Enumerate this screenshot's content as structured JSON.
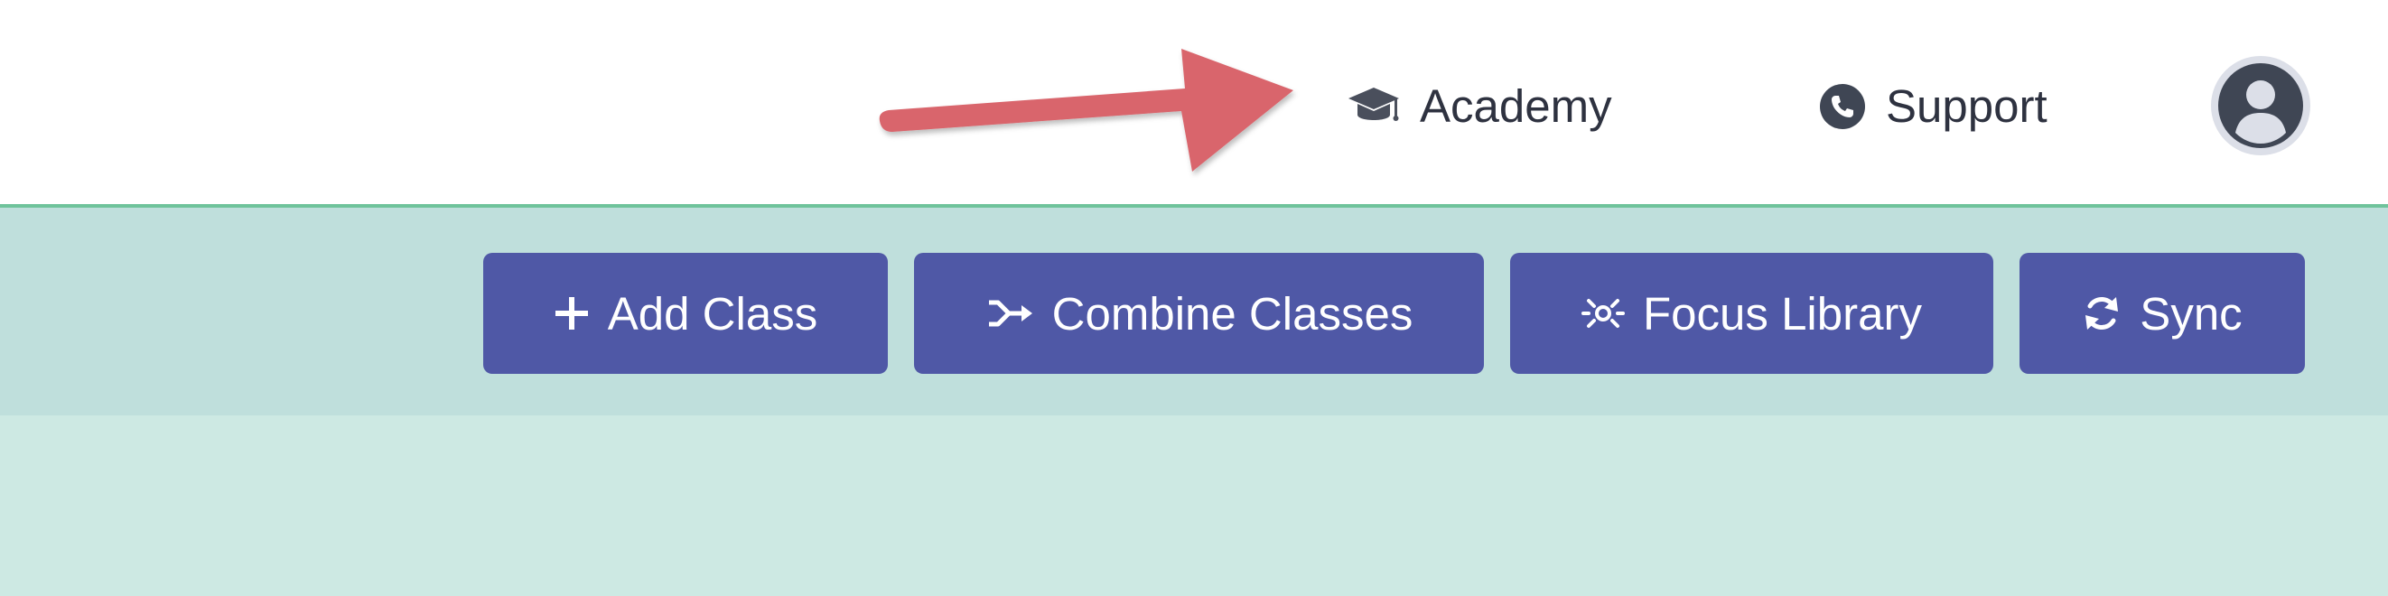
{
  "header": {
    "academy_label": "Academy",
    "support_label": "Support",
    "academy_icon": "graduation-cap-icon",
    "support_icon": "phone-icon",
    "avatar_icon": "user-avatar-icon"
  },
  "toolbar": {
    "buttons": [
      {
        "label": "Add Class",
        "icon": "plus-icon"
      },
      {
        "label": "Combine Classes",
        "icon": "merge-arrow-icon"
      },
      {
        "label": "Focus Library",
        "icon": "focus-icon"
      },
      {
        "label": "Sync",
        "icon": "sync-icon"
      }
    ]
  },
  "colors": {
    "header_border": "#6fc39b",
    "toolbar_bg": "#bfdfdc",
    "content_bg": "#cde9e3",
    "button_bg": "#4f58a6",
    "button_text": "#ffffff",
    "annotation_arrow": "#d9656c"
  }
}
